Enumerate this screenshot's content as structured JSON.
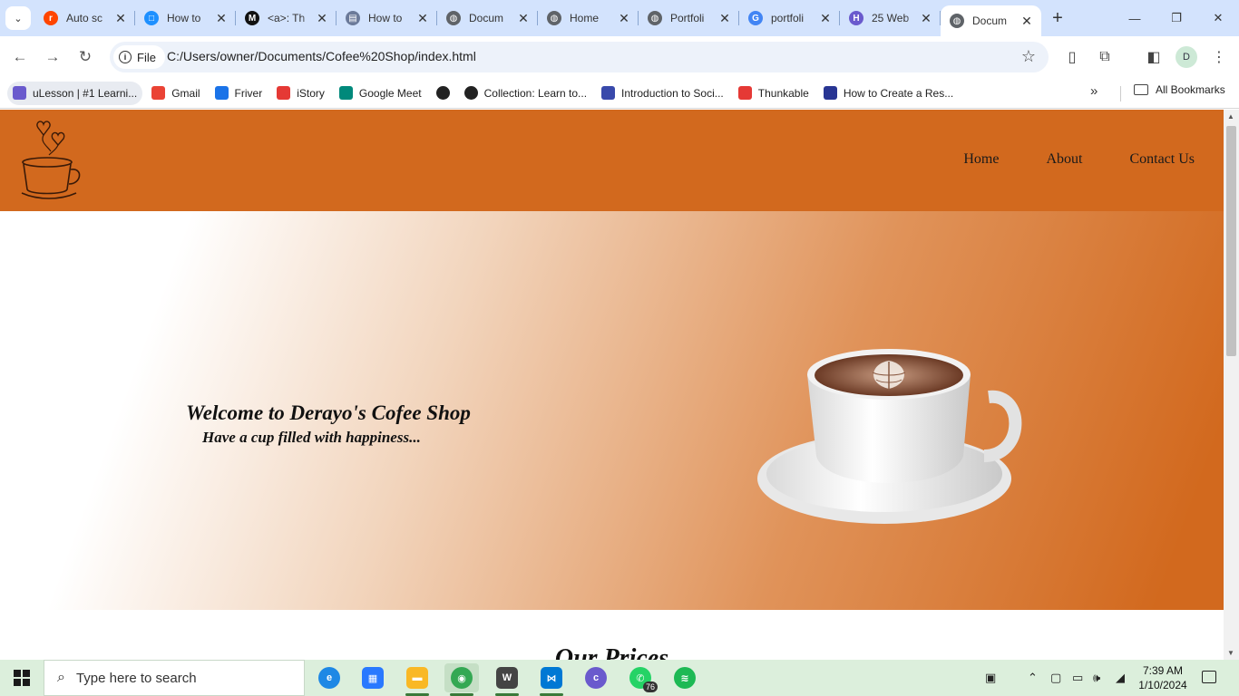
{
  "browser": {
    "tabs": [
      {
        "title": "Auto sc",
        "icon": "reddit-icon",
        "color": "#ff4500",
        "glyph": "r"
      },
      {
        "title": "How to",
        "icon": "page-icon",
        "color": "#1e90ff",
        "glyph": "□"
      },
      {
        "title": "<a>: Th",
        "icon": "mdn-icon",
        "color": "#111111",
        "glyph": "M"
      },
      {
        "title": "How to",
        "icon": "book-icon",
        "color": "#6b7a99",
        "glyph": "▤"
      },
      {
        "title": "Docum",
        "icon": "globe-icon",
        "color": "#5f6368",
        "glyph": "◍"
      },
      {
        "title": "Home",
        "icon": "globe-icon",
        "color": "#5f6368",
        "glyph": "◍"
      },
      {
        "title": "Portfoli",
        "icon": "globe-icon",
        "color": "#5f6368",
        "glyph": "◍"
      },
      {
        "title": "portfoli",
        "icon": "google-icon",
        "color": "#4285f4",
        "glyph": "G"
      },
      {
        "title": "25 Web",
        "icon": "webflow-icon",
        "color": "#6a5acd",
        "glyph": "H"
      },
      {
        "title": "Docum",
        "icon": "globe-icon",
        "color": "#5f6368",
        "glyph": "◍",
        "active": true
      }
    ],
    "address": {
      "chip_label": "File",
      "url": "C:/Users/owner/Documents/Cofee%20Shop/index.html"
    },
    "bookmarks": [
      {
        "label": "uLesson | #1 Learni...",
        "icon": "ulesson-icon",
        "color": "#6a5acd"
      },
      {
        "label": "Gmail",
        "icon": "gmail-icon",
        "color": "#ea4335"
      },
      {
        "label": "Friver",
        "icon": "friver-icon",
        "color": "#1a73e8"
      },
      {
        "label": "iStory",
        "icon": "istory-icon",
        "color": "#e53935"
      },
      {
        "label": "Google Meet",
        "icon": "meet-icon",
        "color": "#00897b"
      },
      {
        "label": "",
        "icon": "globe-icon",
        "color": "#222222"
      },
      {
        "label": "Collection: Learn to...",
        "icon": "github-icon",
        "color": "#222222"
      },
      {
        "label": "Introduction to Soci...",
        "icon": "crest-icon",
        "color": "#3949ab"
      },
      {
        "label": "Thunkable",
        "icon": "thunkable-icon",
        "color": "#e53935"
      },
      {
        "label": "How to Create a Res...",
        "icon": "w3-icon",
        "color": "#283593"
      }
    ],
    "all_bookmarks": "All Bookmarks",
    "profile_initial": "D"
  },
  "site": {
    "nav": [
      "Home",
      "About",
      "Contact Us"
    ],
    "hero_title": "Welcome to Derayo's Cofee Shop",
    "hero_subtitle": "Have a cup filled with happiness...",
    "section_title": "Our Prices",
    "header_color": "#d2691e"
  },
  "taskbar": {
    "search_placeholder": "Type here to search",
    "whatsapp_badge": "76",
    "time": "7:39 AM",
    "date": "1/10/2024"
  }
}
